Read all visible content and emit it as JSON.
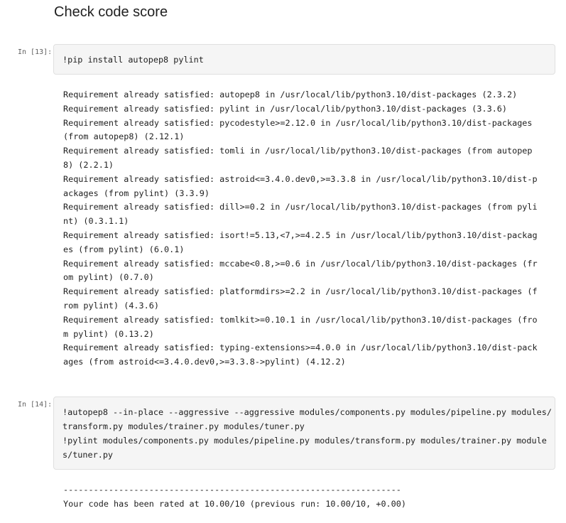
{
  "section": {
    "title": "Check code score"
  },
  "cells": [
    {
      "prompt": "In [13]:",
      "code": [
        "!pip install autopep8 pylint"
      ],
      "output": [
        "Requirement already satisfied: autopep8 in /usr/local/lib/python3.10/dist-packages (2.3.2)",
        "Requirement already satisfied: pylint in /usr/local/lib/python3.10/dist-packages (3.3.6)",
        "Requirement already satisfied: pycodestyle>=2.12.0 in /usr/local/lib/python3.10/dist-packages",
        "(from autopep8) (2.12.1)",
        "Requirement already satisfied: tomli in /usr/local/lib/python3.10/dist-packages (from autopep",
        "8) (2.2.1)",
        "Requirement already satisfied: astroid<=3.4.0.dev0,>=3.3.8 in /usr/local/lib/python3.10/dist-p",
        "ackages (from pylint) (3.3.9)",
        "Requirement already satisfied: dill>=0.2 in /usr/local/lib/python3.10/dist-packages (from pyli",
        "nt) (0.3.1.1)",
        "Requirement already satisfied: isort!=5.13,<7,>=4.2.5 in /usr/local/lib/python3.10/dist-packag",
        "es (from pylint) (6.0.1)",
        "Requirement already satisfied: mccabe<0.8,>=0.6 in /usr/local/lib/python3.10/dist-packages (fr",
        "om pylint) (0.7.0)",
        "Requirement already satisfied: platformdirs>=2.2 in /usr/local/lib/python3.10/dist-packages (f",
        "rom pylint) (4.3.6)",
        "Requirement already satisfied: tomlkit>=0.10.1 in /usr/local/lib/python3.10/dist-packages (fro",
        "m pylint) (0.13.2)",
        "Requirement already satisfied: typing-extensions>=4.0.0 in /usr/local/lib/python3.10/dist-pack",
        "ages (from astroid<=3.4.0.dev0,>=3.3.8->pylint) (4.12.2)"
      ]
    },
    {
      "prompt": "In [14]:",
      "code": [
        "!autopep8 --in-place --aggressive --aggressive modules/components.py modules/pipeline.py modules/",
        "transform.py modules/trainer.py modules/tuner.py",
        "!pylint modules/components.py modules/pipeline.py modules/transform.py modules/trainer.py module",
        "s/tuner.py"
      ],
      "output": [
        "-------------------------------------------------------------------",
        "Your code has been rated at 10.00/10 (previous run: 10.00/10, +0.00)"
      ]
    }
  ]
}
